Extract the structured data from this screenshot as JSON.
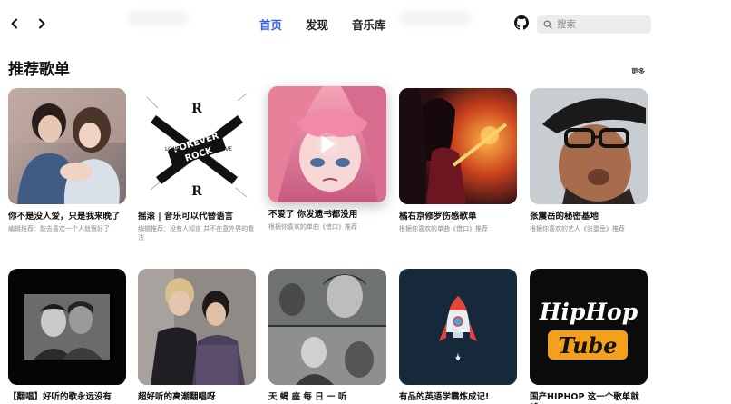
{
  "header": {
    "tabs": [
      {
        "label": "首页",
        "active": true
      },
      {
        "label": "发现",
        "active": false
      },
      {
        "label": "音乐库",
        "active": false
      }
    ],
    "search_placeholder": "搜索",
    "accent": "#335eea"
  },
  "section": {
    "title": "推荐歌单",
    "more_label": "更多"
  },
  "playlists": [
    {
      "title": "你不是没人爱，只是我来晚了",
      "subtitle": "编辑推荐：能去喜欢一个人就很好了"
    },
    {
      "title": "摇滚 | 音乐可以代替语言",
      "subtitle": "编辑推荐：没有人知道 并不在意外界的看法"
    },
    {
      "title": "不爱了 你发遗书都没用",
      "subtitle": "根据你喜欢的单曲《借口》推荐"
    },
    {
      "title": "橘右京修罗伤感歌单",
      "subtitle": "根据你喜欢的单曲《借口》推荐"
    },
    {
      "title": "张震岳的秘密基地",
      "subtitle": "根据你喜欢的艺人《张震岳》推荐"
    },
    {
      "title": "【翻唱】好听的歌永远没有",
      "subtitle": ""
    },
    {
      "title": "超好听的高潮翻唱呀",
      "subtitle": ""
    },
    {
      "title": "天 蝎 座 每 日 一 听",
      "subtitle": ""
    },
    {
      "title": "有品的英语学霸炼成记!",
      "subtitle": ""
    },
    {
      "title": "国产HIPHOP 这一个歌单就够",
      "subtitle": ""
    }
  ],
  "covers": {
    "rock_text": {
      "r": "R",
      "forever": "FOREVER",
      "rock": "ROCK",
      "long": "LONG",
      "live": "LIVE"
    },
    "hiphop_text": {
      "line1": "HipHop",
      "line2": "Tube"
    }
  }
}
